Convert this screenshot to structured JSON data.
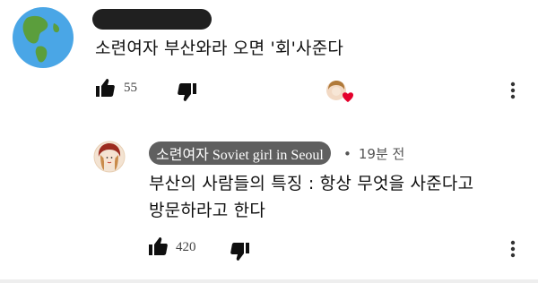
{
  "comment": {
    "author_redacted": true,
    "text": "소련여자 부산와라 오면 '회'사준다",
    "likes": "55",
    "icons": {
      "avatar": "globe-avatar",
      "like": "thumbs-up-icon",
      "dislike": "thumbs-down-icon",
      "heart": "creator-heart-icon",
      "more": "more-vert-icon"
    }
  },
  "reply": {
    "channel_name": "소련여자 Soviet girl in Seoul",
    "separator": "•",
    "time": "19분 전",
    "text_line1": "부산의 사람들의 특징 : 항상 무엇을 사준다고",
    "text_line2": "방문하라고 한다",
    "likes": "420",
    "icons": {
      "avatar": "channel-avatar",
      "like": "thumbs-up-icon",
      "dislike": "thumbs-down-icon",
      "more": "more-vert-icon"
    }
  },
  "colors": {
    "chip_bg": "#5f5f5f",
    "heart": "#e4002b",
    "globe_ocean": "#4aa6e6",
    "globe_land": "#5b9e3c"
  }
}
